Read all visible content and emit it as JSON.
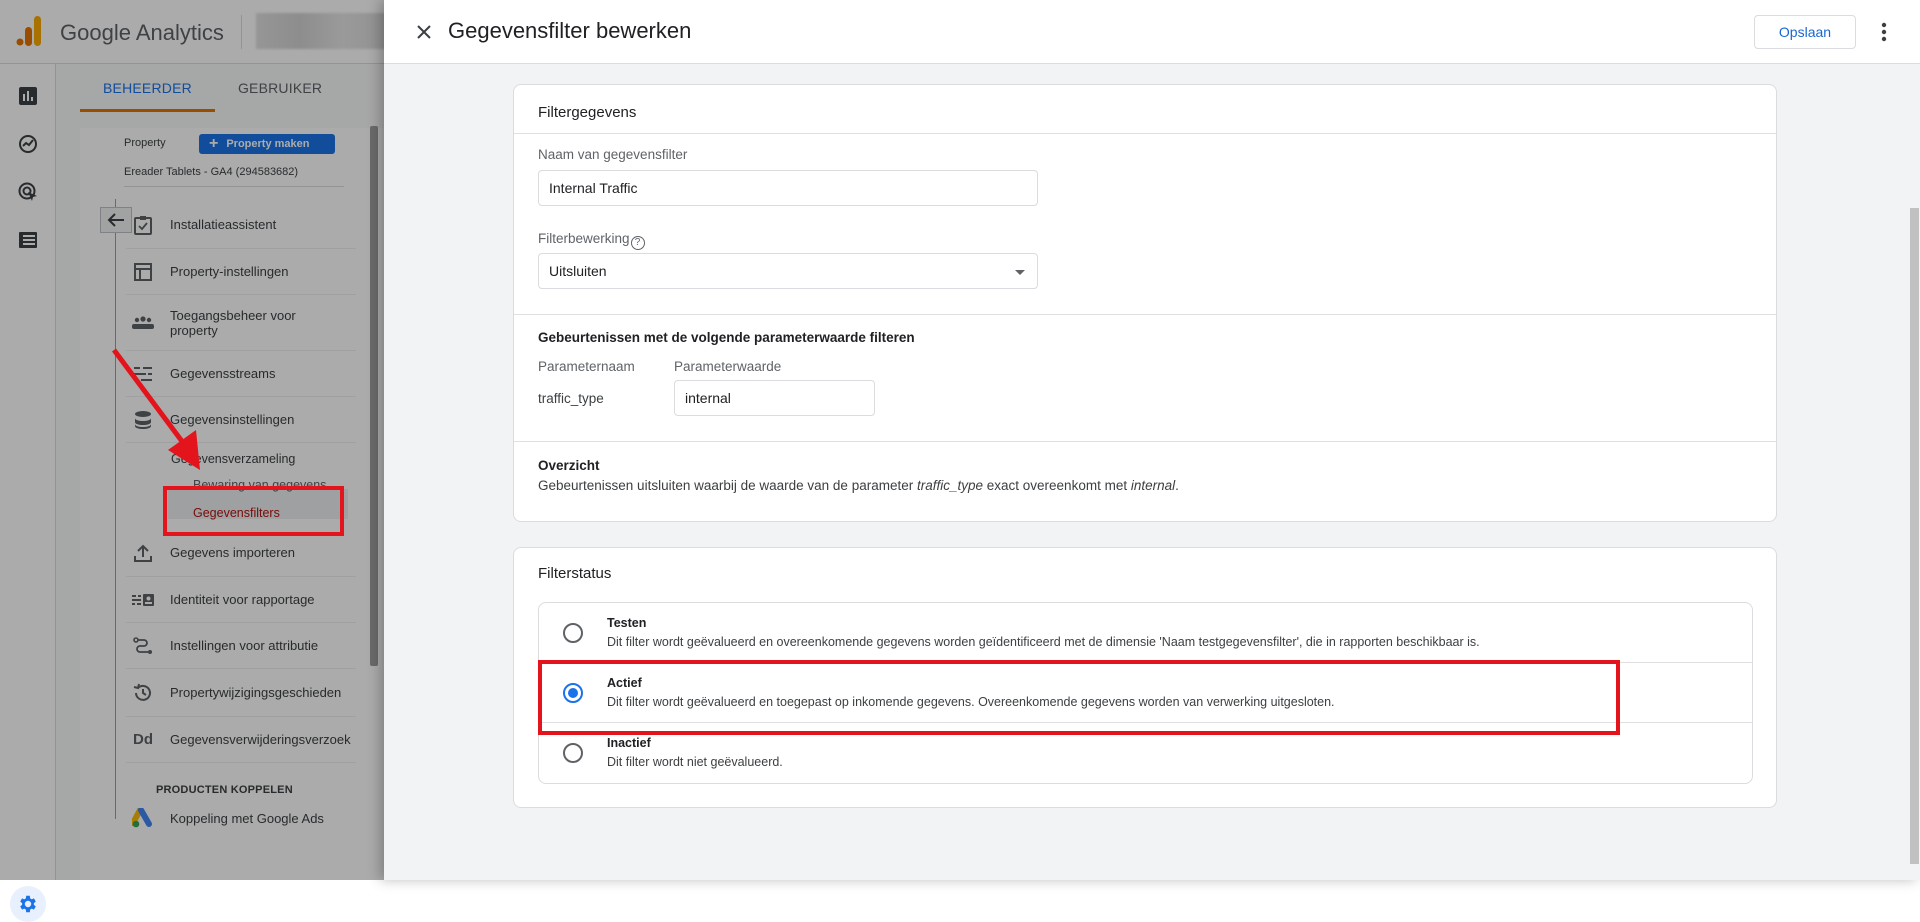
{
  "app": {
    "name": "Google Analytics",
    "tabs": [
      {
        "label": "BEHEERDER",
        "active": true
      },
      {
        "label": "GEBRUIKER",
        "active": false
      }
    ],
    "rail_icons": [
      "reports-icon",
      "explore-icon",
      "advertising-icon",
      "configure-icon"
    ],
    "property": {
      "label": "Property",
      "create_button": "Property maken",
      "name": "Ereader Tablets - GA4 (294583682)"
    },
    "nav_items": [
      {
        "label": "Installatieassistent",
        "icon": "clipboard-check-icon"
      },
      {
        "label": "Property-instellingen",
        "icon": "property-settings-icon"
      },
      {
        "label": "Toegangsbeheer voor property",
        "icon": "people-icon"
      },
      {
        "label": "Gegevensstreams",
        "icon": "streams-icon"
      },
      {
        "label": "Gegevensinstellingen",
        "icon": "database-icon"
      },
      {
        "label": "Gegevens importeren",
        "icon": "upload-icon"
      },
      {
        "label": "Identiteit voor rapportage",
        "icon": "identity-icon"
      },
      {
        "label": "Instellingen voor attributie",
        "icon": "attribution-icon"
      },
      {
        "label": "Propertywijzigingsgeschieden",
        "icon": "history-icon"
      },
      {
        "label": "Gegevensverwijderingsverzoek",
        "icon": "data-deletion-icon",
        "glyph": "Dd"
      }
    ],
    "sub_items": [
      {
        "label": "Gegevensverzameling",
        "active": false
      },
      {
        "label": "Bewaring van gegevens",
        "active": false
      },
      {
        "label": "Gegevensfilters",
        "active": true
      }
    ],
    "section_label": "PRODUCTEN KOPPELEN",
    "link_item": {
      "label": "Koppeling met Google Ads",
      "icon": "google-ads-icon"
    }
  },
  "panel": {
    "title": "Gegevensfilter bewerken",
    "save_label": "Opslaan",
    "filter_details": {
      "title": "Filtergegevens",
      "name_label": "Naam van gegevensfilter",
      "name_value": "Internal Traffic",
      "operation_label": "Filterbewerking",
      "operation_value": "Uitsluiten",
      "params_heading": "Gebeurtenissen met de volgende parameterwaarde filteren",
      "param_name_header": "Parameternaam",
      "param_value_header": "Parameterwaarde",
      "param_name": "traffic_type",
      "param_value": "internal",
      "summary_title": "Overzicht",
      "summary_prefix": "Gebeurtenissen uitsluiten waarbij de waarde van de parameter ",
      "summary_param": "traffic_type",
      "summary_middle": " exact overeenkomt met ",
      "summary_value": "internal",
      "summary_suffix": "."
    },
    "filter_status": {
      "title": "Filterstatus",
      "options": [
        {
          "label": "Testen",
          "description": "Dit filter wordt geëvalueerd en overeenkomende gegevens worden geïdentificeerd met de dimensie 'Naam testgegevensfilter', die in rapporten beschikbaar is.",
          "checked": false
        },
        {
          "label": "Actief",
          "description": "Dit filter wordt geëvalueerd en toegepast op inkomende gegevens. Overeenkomende gegevens worden van verwerking uitgesloten.",
          "checked": true
        },
        {
          "label": "Inactief",
          "description": "Dit filter wordt niet geëvalueerd.",
          "checked": false
        }
      ]
    }
  },
  "colors": {
    "accent": "#1a73e8",
    "annotation": "#e3141b",
    "tab_underline": "#e37400"
  }
}
